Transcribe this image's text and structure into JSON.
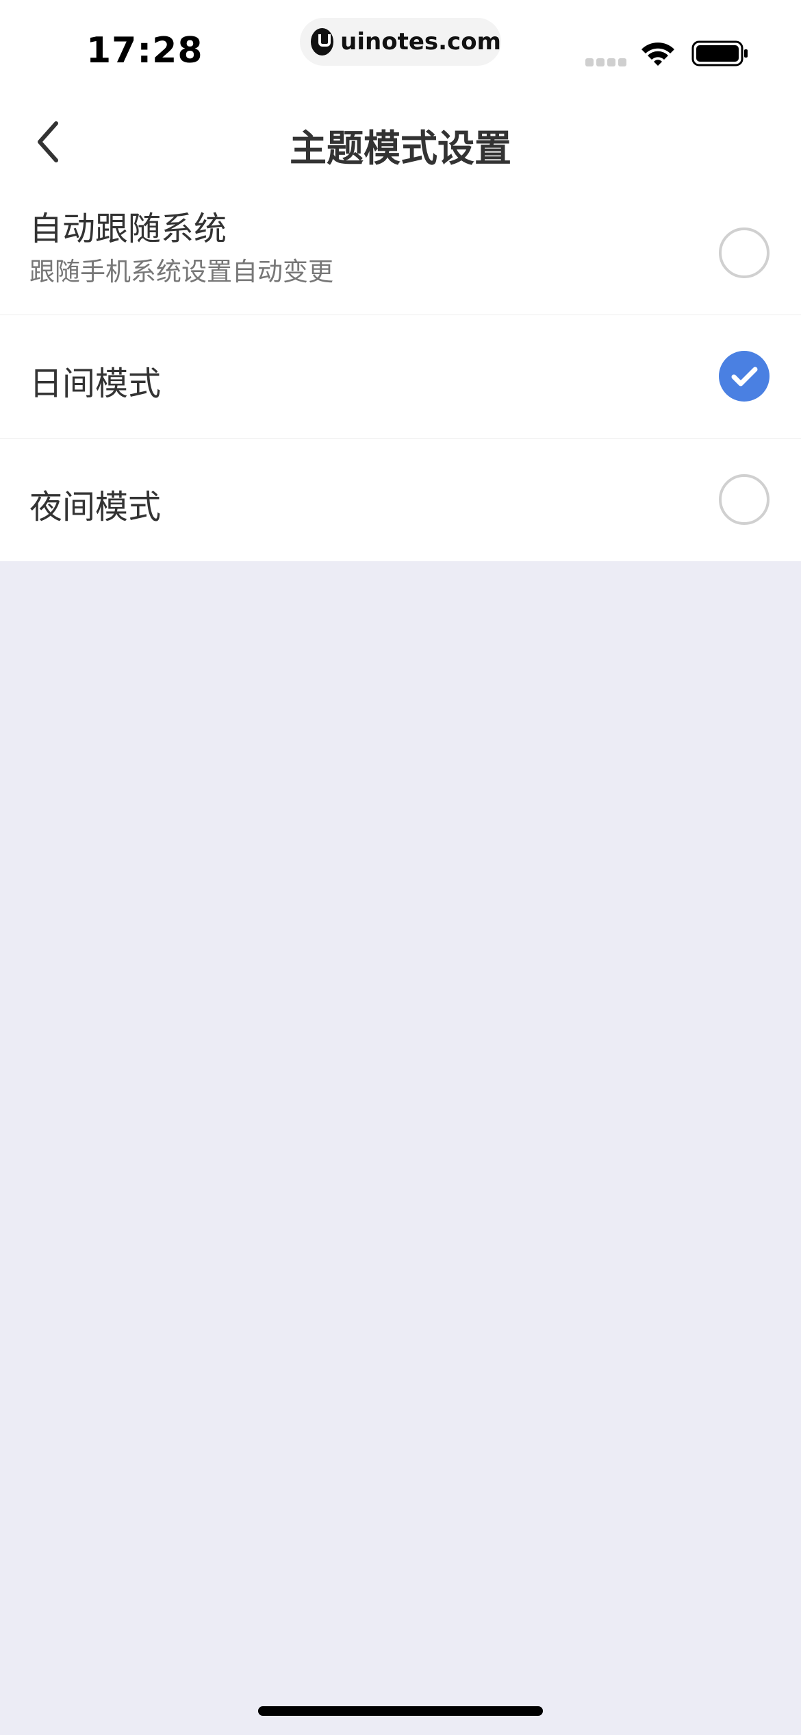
{
  "status_bar": {
    "time": "17:28",
    "url": "uinotes.com"
  },
  "nav": {
    "title": "主题模式设置",
    "back_icon": "chevron-left-icon"
  },
  "options": [
    {
      "title": "自动跟随系统",
      "subtitle": "跟随手机系统设置自动变更",
      "selected": false
    },
    {
      "title": "日间模式",
      "selected": true
    },
    {
      "title": "夜间模式",
      "selected": false
    }
  ],
  "colors": {
    "accent": "#4A80E2",
    "background": "#ECECF5",
    "surface": "#FFFFFF",
    "text_primary": "#333333",
    "text_secondary": "#777777"
  }
}
